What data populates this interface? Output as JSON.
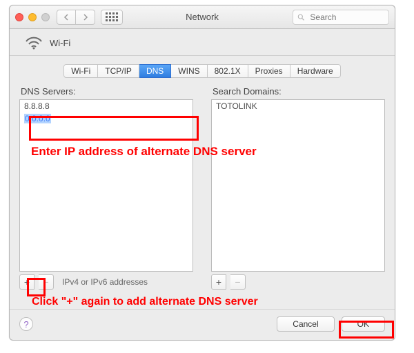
{
  "window": {
    "title": "Network"
  },
  "toolbar": {
    "search_placeholder": "Search"
  },
  "header": {
    "interface_label": "Wi-Fi"
  },
  "tabs": [
    {
      "id": "wifi",
      "label": "Wi-Fi",
      "selected": false
    },
    {
      "id": "tcpip",
      "label": "TCP/IP",
      "selected": false
    },
    {
      "id": "dns",
      "label": "DNS",
      "selected": true
    },
    {
      "id": "wins",
      "label": "WINS",
      "selected": false
    },
    {
      "id": "8021x",
      "label": "802.1X",
      "selected": false
    },
    {
      "id": "proxies",
      "label": "Proxies",
      "selected": false
    },
    {
      "id": "hardware",
      "label": "Hardware",
      "selected": false
    }
  ],
  "dns": {
    "label": "DNS Servers:",
    "entries": [
      {
        "value": "8.8.8.8",
        "editing": false
      },
      {
        "value": "0.0.0.0",
        "editing": true
      }
    ],
    "hint": "IPv4 or IPv6 addresses",
    "add_label": "+",
    "remove_label": "−"
  },
  "search_domains": {
    "label": "Search Domains:",
    "entries": [
      {
        "value": "TOTOLINK"
      }
    ],
    "add_label": "+",
    "remove_label": "−"
  },
  "footer": {
    "help": "?",
    "cancel": "Cancel",
    "ok": "OK"
  },
  "annotations": {
    "text1": "Enter IP address of alternate DNS server",
    "text2": "Click \"+\" again to add alternate DNS server"
  },
  "colors": {
    "accent": "#2f7de0",
    "annotation": "#ff0000"
  }
}
